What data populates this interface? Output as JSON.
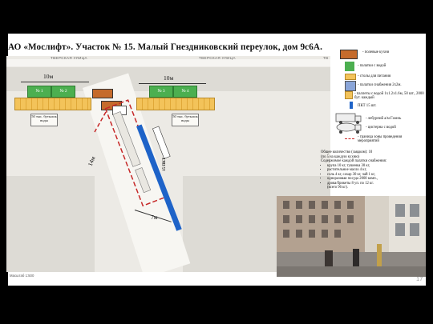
{
  "title": "АО «Мослифт». Участок № 15. Малый Гнездниковский переулок, дом 9с6А.",
  "map": {
    "street_label_left": "ТВЕРСКАЯ УЛИЦА",
    "street_label_right": "ТВЕРСКАЯ УЛИЦА",
    "street_label_edge": "ТВ",
    "dim_left": "10м",
    "dim_right": "10м",
    "dim_vertical": "14м",
    "dim_bottom": "7м",
    "tents": [
      "№ 1",
      "№ 2",
      "№ 3",
      "№ 4"
    ],
    "note_left": "50 тыс. бутылок воды",
    "note_right": "50 тыс. бутылок воды",
    "pkt_label": "15 ПКТ"
  },
  "legend": {
    "items": [
      "- полевые кухни",
      "- палатки с водой",
      "- столы для питания",
      "- палатки снабжения 2х2м.",
      "- паллеты с водой 1х1.2х1.6м, 50 шт., 2000 бут. каждый",
      "ПКТ 15 шт.",
      "- лебурпий а/м Газель",
      "- цистерна с водой",
      "- граница зоны проведения мероприятий"
    ],
    "summary_lines": [
      "Общее количество (заядком): 10",
      "(по 5 на каждую кухню)",
      "Содержимое каждой палатки снабжения:"
    ],
    "bullets": [
      "крупа 10 кг, тушенка 30 кг,",
      "растительное масло 4 кг,",
      "соль 4 кг, сахар 30 кг, чай 1 кг,",
      "одноразовая посуда 2000 комп.,",
      "дрова/брикеты 8 уп. по 12 кг.",
      "(всего 96 кг)."
    ]
  },
  "footer_scale": "Масштаб 1:500",
  "page_number": "17",
  "colors": {
    "green": "#4caf50",
    "blue": "#1e63c8",
    "orange": "#f3c35a",
    "boundary": "#c62828"
  }
}
